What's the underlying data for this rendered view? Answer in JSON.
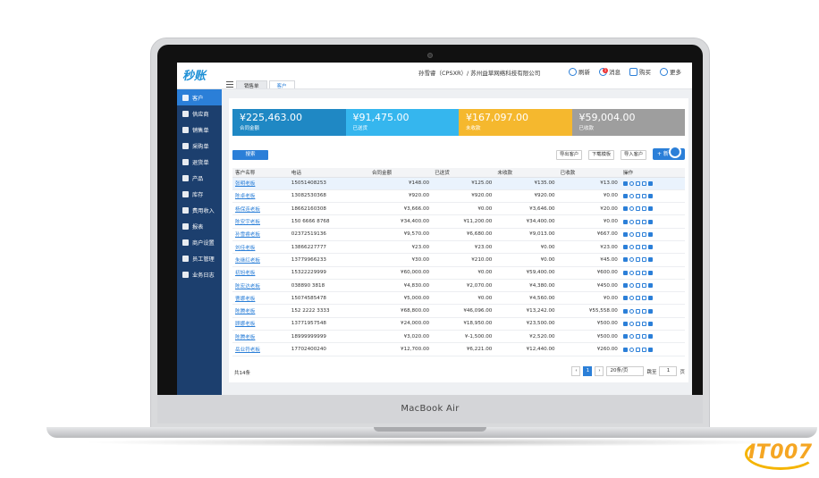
{
  "device": {
    "label": "MacBook Air"
  },
  "watermark": "IT007",
  "app": {
    "logo": "秒账",
    "company": "孙雪睿（CPSXR）/ 苏州益草网络科技有限公司",
    "actions": {
      "refresh": "刷新",
      "messages": "消息",
      "messages_badge": "1",
      "buy": "购买",
      "more": "更多"
    }
  },
  "tabs": [
    {
      "label": "销售单"
    },
    {
      "label": "客户"
    }
  ],
  "sidebar": {
    "items": [
      {
        "label": "客户"
      },
      {
        "label": "供应商"
      },
      {
        "label": "销售单"
      },
      {
        "label": "采购单"
      },
      {
        "label": "退货单"
      },
      {
        "label": "产品"
      },
      {
        "label": "库存"
      },
      {
        "label": "费用收入"
      },
      {
        "label": "报表"
      },
      {
        "label": "商户设置"
      },
      {
        "label": "员工管理"
      },
      {
        "label": "业务日志"
      }
    ]
  },
  "summary": [
    {
      "amount": "¥225,463.00",
      "label": "合同金额",
      "color": "#1f88c4"
    },
    {
      "amount": "¥91,475.00",
      "label": "已送货",
      "color": "#35b6ee"
    },
    {
      "amount": "¥167,097.00",
      "label": "未收款",
      "color": "#f5b82e"
    },
    {
      "amount": "¥59,004.00",
      "label": "已收款",
      "color": "#9e9e9e"
    }
  ],
  "toolbar": {
    "search": "搜索",
    "export": "导出客户",
    "template": "下载模板",
    "import": "导入客户",
    "add": "+ 新"
  },
  "table": {
    "headers": [
      "客户名称",
      "电话",
      "合同金额",
      "已送货",
      "未收款",
      "已收款",
      "操作"
    ],
    "rows": [
      [
        "张明老板",
        "15051408253",
        "¥148.00",
        "¥125.00",
        "¥135.00",
        "¥13.00"
      ],
      [
        "陈卓老板",
        "13082530368",
        "¥920.00",
        "¥920.00",
        "¥920.00",
        "¥0.00"
      ],
      [
        "杨保连老板",
        "18662160308",
        "¥3,666.00",
        "¥0.00",
        "¥3,646.00",
        "¥20.00"
      ],
      [
        "陈安宇老板",
        "150 6666 8768",
        "¥34,400.00",
        "¥11,200.00",
        "¥34,400.00",
        "¥0.00"
      ],
      [
        "孙雪睿老板",
        "02372519136",
        "¥9,570.00",
        "¥6,680.00",
        "¥9,013.00",
        "¥667.00"
      ],
      [
        "刘佳老板",
        "13866227777",
        "¥23.00",
        "¥23.00",
        "¥0.00",
        "¥23.00"
      ],
      [
        "朱继红老板",
        "13779966233",
        "¥30.00",
        "¥210.00",
        "¥0.00",
        "¥45.00"
      ],
      [
        "初旭老板",
        "15322229999",
        "¥60,000.00",
        "¥0.00",
        "¥59,400.00",
        "¥600.00"
      ],
      [
        "陈宏达老板",
        "038890 3818",
        "¥4,830.00",
        "¥2,070.00",
        "¥4,380.00",
        "¥450.00"
      ],
      [
        "曹娜老板",
        "15074585478",
        "¥5,000.00",
        "¥0.00",
        "¥4,560.00",
        "¥0.00"
      ],
      [
        "陈腾老板",
        "152 2222 3333",
        "¥68,800.00",
        "¥46,096.00",
        "¥13,242.00",
        "¥55,558.00"
      ],
      [
        "顾娜老板",
        "13771957548",
        "¥24,000.00",
        "¥18,950.00",
        "¥23,500.00",
        "¥500.00"
      ],
      [
        "陈腾老板",
        "18999999999",
        "¥3,020.00",
        "¥-1,500.00",
        "¥2,520.00",
        "¥500.00"
      ],
      [
        "岳业符老板",
        "17702400240",
        "¥12,700.00",
        "¥6,221.00",
        "¥12,440.00",
        "¥260.00"
      ]
    ]
  },
  "pagination": {
    "total": "共14条",
    "prev": "‹",
    "current": "1",
    "next": "›",
    "page_size": "20条/页",
    "goto": "跳至",
    "goto_value": "1",
    "page_unit": "页"
  }
}
